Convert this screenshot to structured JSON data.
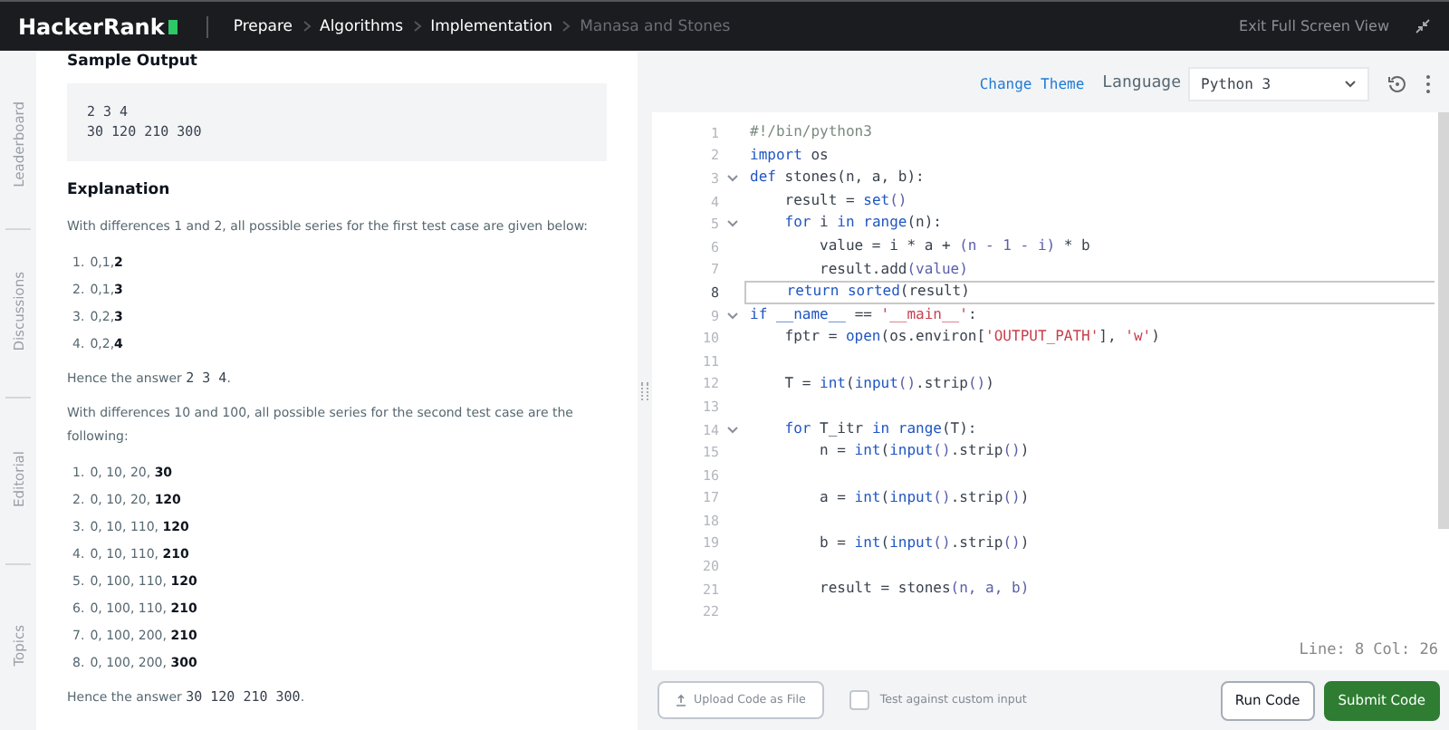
{
  "topbar": {
    "logo": "HackerRank",
    "breadcrumbs": [
      {
        "label": "Prepare",
        "current": false
      },
      {
        "label": "Algorithms",
        "current": false
      },
      {
        "label": "Implementation",
        "current": false
      },
      {
        "label": "Manasa and Stones",
        "current": true
      }
    ],
    "exit": "Exit Full Screen View"
  },
  "side_tabs": [
    "Leaderboard",
    "Discussions",
    "Editorial",
    "Topics"
  ],
  "problem": {
    "sample_heading": "Sample Output",
    "sample_lines": [
      "2 3 4",
      "30 120 210 300"
    ],
    "explanation_heading": "Explanation",
    "blocks": [
      {
        "kind": "para",
        "text": "With differences 1 and 2, all possible series for the first test case are given below:"
      },
      {
        "kind": "list",
        "items": [
          {
            "number": "1.",
            "text": "0,1,**2**"
          },
          {
            "number": "2.",
            "text": "0,1,**3**"
          },
          {
            "number": "3.",
            "text": "0,2,**3**"
          },
          {
            "number": "4.",
            "text": "0,2,**4**"
          }
        ]
      },
      {
        "kind": "answer",
        "text": "Hence the answer ",
        "code": "2 3 4",
        "end": "."
      },
      {
        "kind": "para",
        "text": "With differences 10 and 100, all possible series for the second test case are the following:"
      },
      {
        "kind": "list",
        "items": [
          {
            "number": "1.",
            "text": "0, 10, 20, **30**"
          },
          {
            "number": "2.",
            "text": "0, 10, 20, **120**"
          },
          {
            "number": "3.",
            "text": "0, 10, 110, **120**"
          },
          {
            "number": "4.",
            "text": "0, 10, 110, **210**"
          },
          {
            "number": "5.",
            "text": "0, 100, 110, **120**"
          },
          {
            "number": "6.",
            "text": "0, 100, 110, **210**"
          },
          {
            "number": "7.",
            "text": "0, 100, 200, **210**"
          },
          {
            "number": "8.",
            "text": "0, 100, 200, **300**"
          }
        ]
      },
      {
        "kind": "answer",
        "text": "Hence the answer ",
        "code": "30 120 210 300",
        "end": "."
      }
    ]
  },
  "editor": {
    "change_theme": "Change Theme",
    "language_label": "Language",
    "language": "Python 3",
    "lines": [
      {
        "number": "1",
        "fold": false,
        "current": false,
        "tokens": [
          {
            "kind": "comment",
            "text": "#!/bin/python3"
          }
        ]
      },
      {
        "number": "2",
        "fold": false,
        "current": false,
        "tokens": [
          {
            "kind": "kw",
            "text": "import"
          },
          {
            "kind": "plain",
            "text": " os"
          }
        ]
      },
      {
        "number": "3",
        "fold": true,
        "current": false,
        "tokens": [
          {
            "kind": "kw",
            "text": "def"
          },
          {
            "kind": "plain",
            "text": " stones(n, a, b):"
          }
        ]
      },
      {
        "number": "4",
        "fold": false,
        "current": false,
        "tokens": [
          {
            "kind": "plain",
            "text": "    result = "
          },
          {
            "kind": "fn",
            "text": "set"
          },
          {
            "kind": "paren",
            "text": "()"
          }
        ]
      },
      {
        "number": "5",
        "fold": true,
        "current": false,
        "tokens": [
          {
            "kind": "kw",
            "text": "    for"
          },
          {
            "kind": "plain",
            "text": " i "
          },
          {
            "kind": "kw",
            "text": "in"
          },
          {
            "kind": "fn",
            "text": " range"
          },
          {
            "kind": "plain",
            "text": "(n):"
          }
        ]
      },
      {
        "number": "6",
        "fold": false,
        "current": false,
        "tokens": [
          {
            "kind": "plain",
            "text": "        value = i * a + "
          },
          {
            "kind": "paren",
            "text": "(n - 1 - i)"
          },
          {
            "kind": "plain",
            "text": " * b"
          }
        ]
      },
      {
        "number": "7",
        "fold": false,
        "current": false,
        "tokens": [
          {
            "kind": "plain",
            "text": "        result.add"
          },
          {
            "kind": "paren",
            "text": "(value)"
          }
        ]
      },
      {
        "number": "8",
        "fold": false,
        "current": true,
        "tokens": [
          {
            "kind": "kw",
            "text": "    return"
          },
          {
            "kind": "fn",
            "text": " sorted"
          },
          {
            "kind": "plain",
            "text": "(result)"
          }
        ]
      },
      {
        "number": "9",
        "fold": true,
        "current": false,
        "tokens": [
          {
            "kind": "kw",
            "text": "if"
          },
          {
            "kind": "fn",
            "text": " __name__"
          },
          {
            "kind": "plain",
            "text": " == "
          },
          {
            "kind": "str",
            "text": "'__main__'"
          },
          {
            "kind": "plain",
            "text": ":"
          }
        ]
      },
      {
        "number": "10",
        "fold": false,
        "current": false,
        "tokens": [
          {
            "kind": "plain",
            "text": "    fptr = "
          },
          {
            "kind": "fn",
            "text": "open"
          },
          {
            "kind": "plain",
            "text": "(os.environ["
          },
          {
            "kind": "str",
            "text": "'OUTPUT_PATH'"
          },
          {
            "kind": "plain",
            "text": "], "
          },
          {
            "kind": "str",
            "text": "'w'"
          },
          {
            "kind": "plain",
            "text": ")"
          }
        ]
      },
      {
        "number": "11",
        "fold": false,
        "current": false
      },
      {
        "number": "12",
        "fold": false,
        "current": false,
        "tokens": [
          {
            "kind": "plain",
            "text": "    T = "
          },
          {
            "kind": "fn",
            "text": "int"
          },
          {
            "kind": "plain",
            "text": "("
          },
          {
            "kind": "fn",
            "text": "input"
          },
          {
            "kind": "paren",
            "text": "()"
          },
          {
            "kind": "plain",
            "text": ".strip"
          },
          {
            "kind": "paren",
            "text": "()"
          },
          {
            "kind": "plain",
            "text": ")"
          }
        ]
      },
      {
        "number": "13",
        "fold": false,
        "current": false
      },
      {
        "number": "14",
        "fold": true,
        "current": false,
        "tokens": [
          {
            "kind": "kw",
            "text": "    for"
          },
          {
            "kind": "plain",
            "text": " T_itr "
          },
          {
            "kind": "kw",
            "text": "in"
          },
          {
            "kind": "fn",
            "text": " range"
          },
          {
            "kind": "plain",
            "text": "(T):"
          }
        ]
      },
      {
        "number": "15",
        "fold": false,
        "current": false,
        "tokens": [
          {
            "kind": "plain",
            "text": "        n = "
          },
          {
            "kind": "fn",
            "text": "int"
          },
          {
            "kind": "plain",
            "text": "("
          },
          {
            "kind": "fn",
            "text": "input"
          },
          {
            "kind": "paren",
            "text": "()"
          },
          {
            "kind": "plain",
            "text": ".strip"
          },
          {
            "kind": "paren",
            "text": "()"
          },
          {
            "kind": "plain",
            "text": ")"
          }
        ]
      },
      {
        "number": "16",
        "fold": false,
        "current": false
      },
      {
        "number": "17",
        "fold": false,
        "current": false,
        "tokens": [
          {
            "kind": "plain",
            "text": "        a = "
          },
          {
            "kind": "fn",
            "text": "int"
          },
          {
            "kind": "plain",
            "text": "("
          },
          {
            "kind": "fn",
            "text": "input"
          },
          {
            "kind": "paren",
            "text": "()"
          },
          {
            "kind": "plain",
            "text": ".strip"
          },
          {
            "kind": "paren",
            "text": "()"
          },
          {
            "kind": "plain",
            "text": ")"
          }
        ]
      },
      {
        "number": "18",
        "fold": false,
        "current": false
      },
      {
        "number": "19",
        "fold": false,
        "current": false,
        "tokens": [
          {
            "kind": "plain",
            "text": "        b = "
          },
          {
            "kind": "fn",
            "text": "int"
          },
          {
            "kind": "plain",
            "text": "("
          },
          {
            "kind": "fn",
            "text": "input"
          },
          {
            "kind": "paren",
            "text": "()"
          },
          {
            "kind": "plain",
            "text": ".strip"
          },
          {
            "kind": "paren",
            "text": "()"
          },
          {
            "kind": "plain",
            "text": ")"
          }
        ]
      },
      {
        "number": "20",
        "fold": false,
        "current": false
      },
      {
        "number": "21",
        "fold": false,
        "current": false,
        "tokens": [
          {
            "kind": "plain",
            "text": "        result = stones"
          },
          {
            "kind": "paren",
            "text": "(n, a, b)"
          }
        ]
      },
      {
        "number": "22",
        "fold": false,
        "current": false
      }
    ],
    "cursor_status": "Line: 8 Col: 26"
  },
  "footer": {
    "upload": "Upload Code as File",
    "custom_input": {
      "label": "Test against custom input",
      "checked": false
    },
    "run": "Run Code",
    "submit": "Submit Code"
  }
}
